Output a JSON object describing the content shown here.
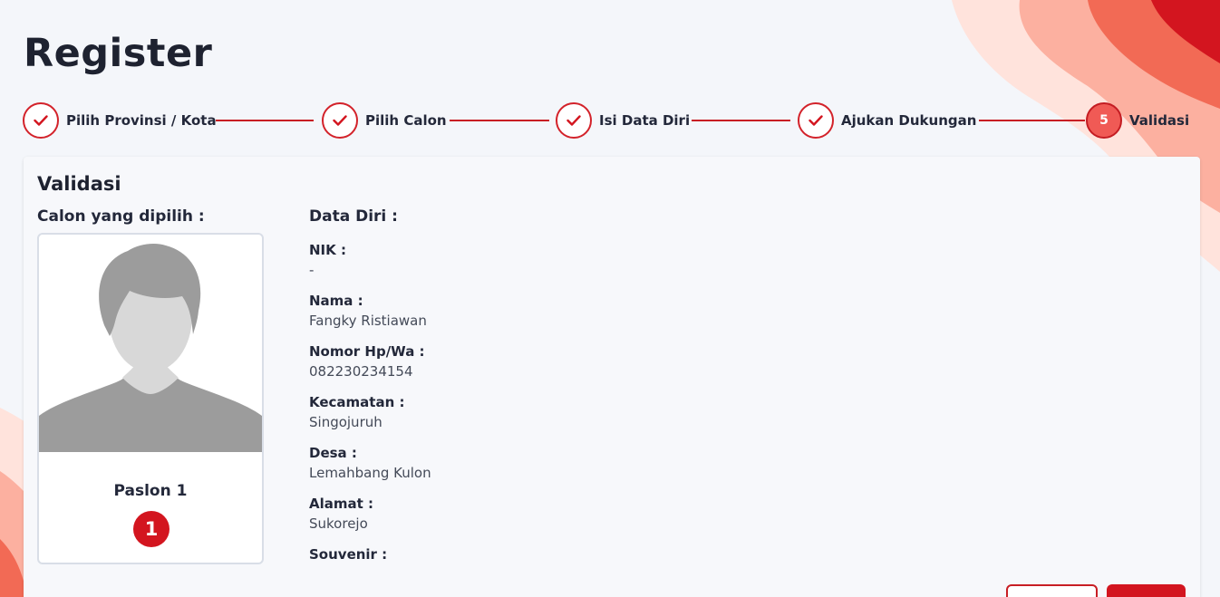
{
  "page": {
    "title": "Register"
  },
  "stepper": {
    "steps": [
      {
        "label": "Pilih Provinsi / Kota",
        "status": "done"
      },
      {
        "label": "Pilih Calon",
        "status": "done"
      },
      {
        "label": "Isi Data Diri",
        "status": "done"
      },
      {
        "label": "Ajukan Dukungan",
        "status": "done"
      },
      {
        "label": "Validasi",
        "status": "active",
        "number": "5"
      }
    ]
  },
  "validasi": {
    "title": "Validasi",
    "calon_heading": "Calon yang dipilih :",
    "data_heading": "Data Diri :",
    "candidate": {
      "name": "Paslon 1",
      "number": "1"
    },
    "fields": [
      {
        "label": "NIK :",
        "value": "-"
      },
      {
        "label": "Nama :",
        "value": "Fangky Ristiawan"
      },
      {
        "label": "Nomor Hp/Wa :",
        "value": "082230234154"
      },
      {
        "label": "Kecamatan :",
        "value": "Singojuruh"
      },
      {
        "label": "Desa :",
        "value": "Lemahbang Kulon"
      },
      {
        "label": "Alamat :",
        "value": "Sukorejo"
      },
      {
        "label": "Souvenir :",
        "value": ""
      }
    ]
  },
  "colors": {
    "accent": "#d3151f",
    "step_active": "#f05a55",
    "background": "#f4f6fa"
  }
}
